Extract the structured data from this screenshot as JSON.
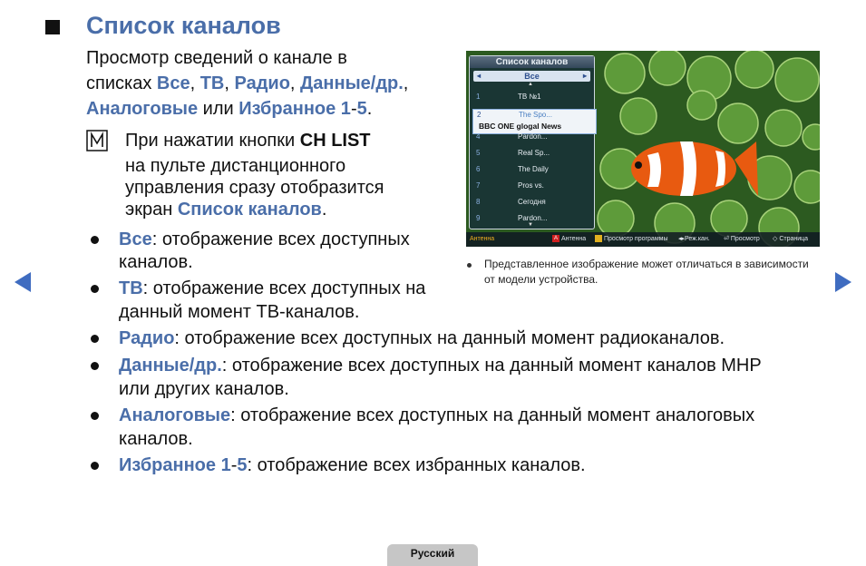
{
  "title": "Список каналов",
  "intro": {
    "l1": "Просмотр сведений о канале в",
    "l2_a": "списках ",
    "all": "Все",
    "sep1": ", ",
    "tv": "ТВ",
    "sep2": ", ",
    "radio": "Радио",
    "sep3": ", ",
    "data": "Данные/др.",
    "sep4": ",",
    "analog": "Аналоговые",
    "or": " или ",
    "fav": "Избранное 1",
    "dash": "-",
    "five": "5",
    "dot": "."
  },
  "note": {
    "l1_a": "При нажатии кнопки ",
    "l1_b": "CH LIST",
    "l2": "на пульте дистанционного",
    "l3": "управления сразу отобразится",
    "l4_a": "экран ",
    "l4_b": "Список каналов",
    "l4_c": "."
  },
  "bullets": {
    "all_term": "Все",
    "all_l1": ": отображение всех доступных",
    "all_l2": "каналов.",
    "tv_term": "ТВ",
    "tv_l1": ": отображение всех доступных на",
    "tv_l2": "данный момент ТВ-каналов.",
    "radio_term": "Радио",
    "radio_l1": ": отображение всех доступных на данный момент радиоканалов.",
    "data_term": "Данные/др.",
    "data_l1": ": отображение всех доступных на данный момент каналов MHP",
    "data_l2": "или других каналов.",
    "analog_term": "Аналоговые",
    "analog_l1": ": отображение всех доступных на данный момент аналоговых",
    "analog_l2": "каналов.",
    "fav_term": "Избранное 1",
    "fav_dash": "-",
    "fav_five": "5",
    "fav_l1": ": отображение всех избранных каналов."
  },
  "tv_osd": {
    "title": "Список каналов",
    "tab": "Все",
    "channels": [
      {
        "num": "1",
        "name": "ТВ №1"
      },
      {
        "num": "2",
        "name": "The Spo..."
      },
      {
        "num": "4",
        "name": "Pardon..."
      },
      {
        "num": "5",
        "name": "Real Sp..."
      },
      {
        "num": "6",
        "name": "The Daily"
      },
      {
        "num": "7",
        "name": "Pros vs."
      },
      {
        "num": "8",
        "name": "Сегодня"
      },
      {
        "num": "9",
        "name": "Pardon..."
      }
    ],
    "selected_info": "BBC ONE glogal News",
    "bar": {
      "source": "Антенна",
      "key_a": "Антенна",
      "key_b": "Просмотр программы",
      "key_mode": "Реж.кан.",
      "key_view": "Просмотр",
      "key_page": "Страница"
    }
  },
  "caption": "Представленное изображение может отличаться в зависимости от модели устройства.",
  "language": "Русский"
}
